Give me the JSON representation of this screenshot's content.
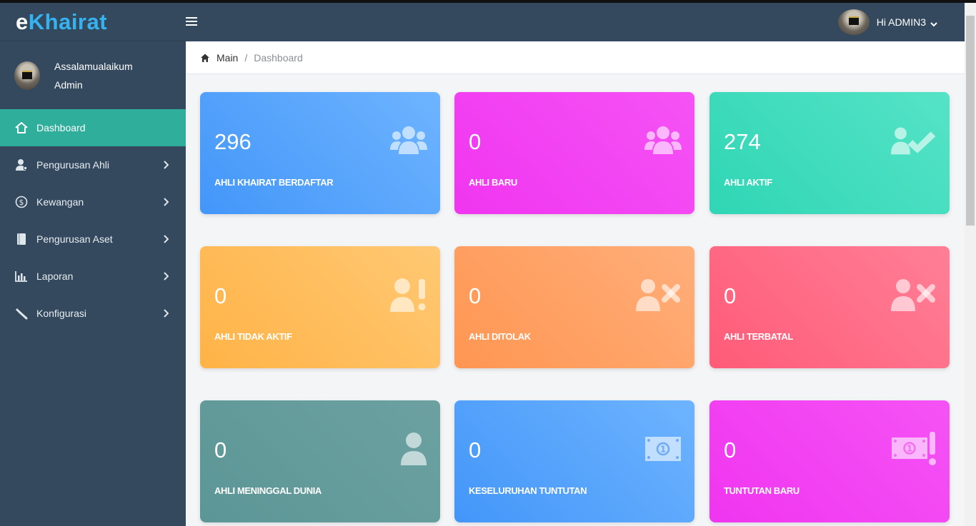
{
  "app": {
    "brand_prefix": "e",
    "brand_main": "Khairat"
  },
  "user_panel": {
    "greeting": "Assalamualaikum",
    "role": "Admin"
  },
  "topbar": {
    "admin_label": "Hi ADMIN3"
  },
  "breadcrumb": {
    "main": "Main",
    "separator": "/",
    "current": "Dashboard"
  },
  "sidebar": {
    "items": [
      {
        "label": "Dashboard",
        "icon": "home-icon",
        "active": true
      },
      {
        "label": "Pengurusan Ahli",
        "icon": "user-admin-icon",
        "has_submenu": true
      },
      {
        "label": "Kewangan",
        "icon": "dollar-circle-icon",
        "has_submenu": true
      },
      {
        "label": "Pengurusan Aset",
        "icon": "book-icon",
        "has_submenu": true
      },
      {
        "label": "Laporan",
        "icon": "bar-chart-icon",
        "has_submenu": true
      },
      {
        "label": "Konfigurasi",
        "icon": "wrench-icon",
        "has_submenu": true
      }
    ]
  },
  "cards": [
    {
      "value": "296",
      "label": "AHLI KHAIRAT BERDAFTAR",
      "icon": "users-icon",
      "color": "#4396f9"
    },
    {
      "value": "0",
      "label": "AHLI BARU",
      "icon": "users-icon",
      "color": "#f035f0"
    },
    {
      "value": "274",
      "label": "AHLI AKTIF",
      "icon": "user-check-icon",
      "color": "#2fd6b5"
    },
    {
      "value": "0",
      "label": "AHLI TIDAK AKTIF",
      "icon": "user-exclamation-icon",
      "color": "#ffb347"
    },
    {
      "value": "0",
      "label": "AHLI DITOLAK",
      "icon": "user-x-icon",
      "color": "#ff9652"
    },
    {
      "value": "0",
      "label": "AHLI TERBATAL",
      "icon": "user-x-icon",
      "color": "#ff5b78"
    },
    {
      "value": "0",
      "label": "AHLI MENINGGAL DUNIA",
      "icon": "user-icon",
      "color": "#5c9696"
    },
    {
      "value": "0",
      "label": "KESELURUHAN TUNTUTAN",
      "icon": "money-bill-icon",
      "color": "#4396f9"
    },
    {
      "value": "0",
      "label": "TUNTUTAN BARU",
      "icon": "money-bill-exclamation-icon",
      "color": "#f035f0"
    }
  ]
}
